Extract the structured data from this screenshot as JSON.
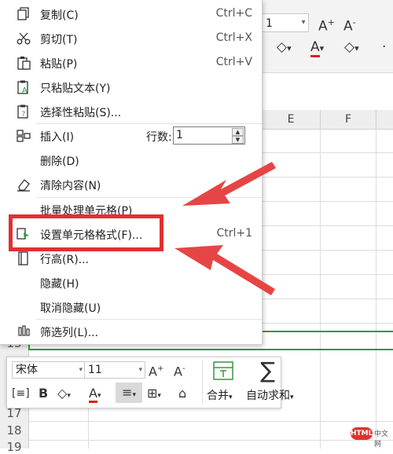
{
  "menu": {
    "items": [
      {
        "label": "复制(C)",
        "shortcut": "Ctrl+C",
        "icon": "copy-icon"
      },
      {
        "label": "剪切(T)",
        "shortcut": "Ctrl+X",
        "icon": "scissors-icon"
      },
      {
        "label": "粘贴(P)",
        "shortcut": "Ctrl+V",
        "icon": "paste-icon"
      },
      {
        "label": "只粘贴文本(Y)",
        "shortcut": "",
        "icon": "paste-text-icon"
      },
      {
        "label": "选择性粘贴(S)...",
        "shortcut": "",
        "icon": "paste-special-icon"
      },
      {
        "label": "插入(I)",
        "shortcut": "",
        "icon": "insert-icon"
      },
      {
        "label": "删除(D)",
        "shortcut": "",
        "icon": ""
      },
      {
        "label": "清除内容(N)",
        "shortcut": "",
        "icon": "eraser-icon"
      },
      {
        "label": "批量处理单元格(P)",
        "shortcut": "",
        "icon": ""
      },
      {
        "label": "设置单元格格式(F)...",
        "shortcut": "Ctrl+1",
        "icon": "format-cells-icon"
      },
      {
        "label": "行高(R)...",
        "shortcut": "",
        "icon": "row-height-icon"
      },
      {
        "label": "隐藏(H)",
        "shortcut": "",
        "icon": ""
      },
      {
        "label": "取消隐藏(U)",
        "shortcut": "",
        "icon": ""
      },
      {
        "label": "筛选列(L)...",
        "shortcut": "",
        "icon": "filter-columns-icon"
      }
    ],
    "insert_rows_label": "行数:",
    "insert_rows_value": "1"
  },
  "ribbon": {
    "font_size": "1",
    "grow_font": "A⁺",
    "shrink_font": "A⁻"
  },
  "grid": {
    "columns": [
      "E",
      "F"
    ],
    "rows": [
      "13",
      "16",
      "17",
      "18",
      "19"
    ]
  },
  "mini_toolbar": {
    "font_name": "宋体",
    "font_size": "11",
    "grow_font": "A⁺",
    "shrink_font": "A⁻",
    "bold": "B",
    "merge_label": "合并",
    "autosum_label": "自动求和"
  },
  "watermark": {
    "badge": "HTML",
    "text": "中文网"
  },
  "colors": {
    "highlight": "#e03131",
    "selection": "#2e9a3a",
    "font_color": "#e02020"
  }
}
